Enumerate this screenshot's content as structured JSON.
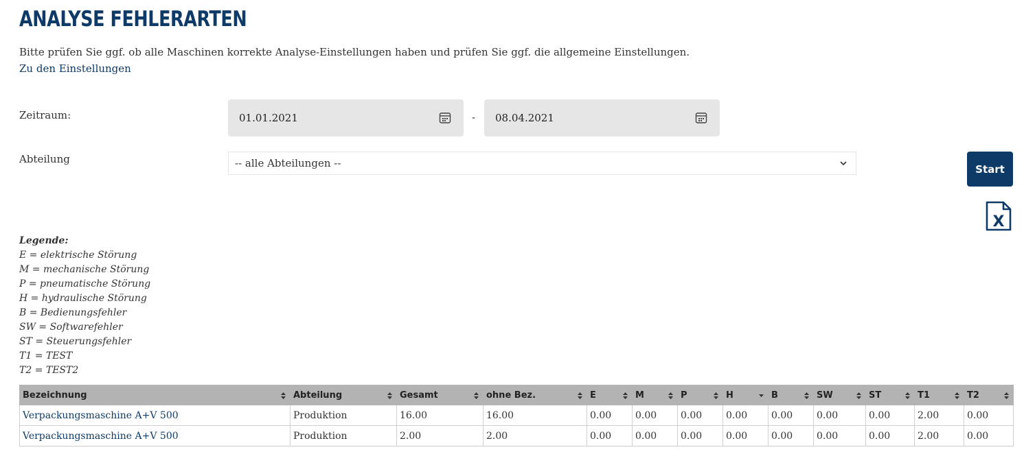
{
  "page": {
    "title": "ANALYSE FEHLERARTEN",
    "intro_text": "Bitte prüfen Sie ggf. ob alle Maschinen korrekte Analyse-Einstellungen haben und prüfen Sie ggf. die allgemeine Einstellungen.",
    "settings_link": "Zu den Einstellungen"
  },
  "filters": {
    "period_label": "Zeitraum:",
    "date_from": "01.01.2021",
    "date_separator": "-",
    "date_to": "08.04.2021",
    "department_label": "Abteilung",
    "department_selected": "-- alle Abteilungen --",
    "start_label": "Start"
  },
  "legend": {
    "title": "Legende:",
    "items": [
      "E = elektrische Störung",
      "M = mechanische Störung",
      "P = pneumatische Störung",
      "H = hydraulische Störung",
      "B = Bedienungsfehler",
      "SW = Softwarefehler",
      "ST = Steuerungsfehler",
      "T1 = TEST",
      "T2 = TEST2"
    ]
  },
  "table": {
    "headers": [
      "Bezeichnung",
      "Abteilung",
      "Gesamt",
      "ohne Bez.",
      "E",
      "M",
      "P",
      "H",
      "B",
      "SW",
      "ST",
      "T1",
      "T2"
    ],
    "sorted_column": "H",
    "rows": [
      [
        "Verpackungsmaschine A+V 500",
        "Produktion",
        "16.00",
        "16.00",
        "0.00",
        "0.00",
        "0.00",
        "0.00",
        "0.00",
        "0.00",
        "0.00",
        "2.00",
        "0.00"
      ],
      [
        "Verpackungsmaschine A+V 500",
        "Produktion",
        "2.00",
        "2.00",
        "0.00",
        "0.00",
        "0.00",
        "0.00",
        "0.00",
        "0.00",
        "0.00",
        "2.00",
        "0.00"
      ]
    ]
  },
  "colors": {
    "brand": "#0d3a66",
    "header_bg": "#b3b3b3",
    "field_bg": "#e6e6e6"
  },
  "icons": [
    "calendar-icon",
    "chevron-down-icon",
    "excel-export-icon",
    "sort-icon",
    "sort-desc-icon"
  ]
}
